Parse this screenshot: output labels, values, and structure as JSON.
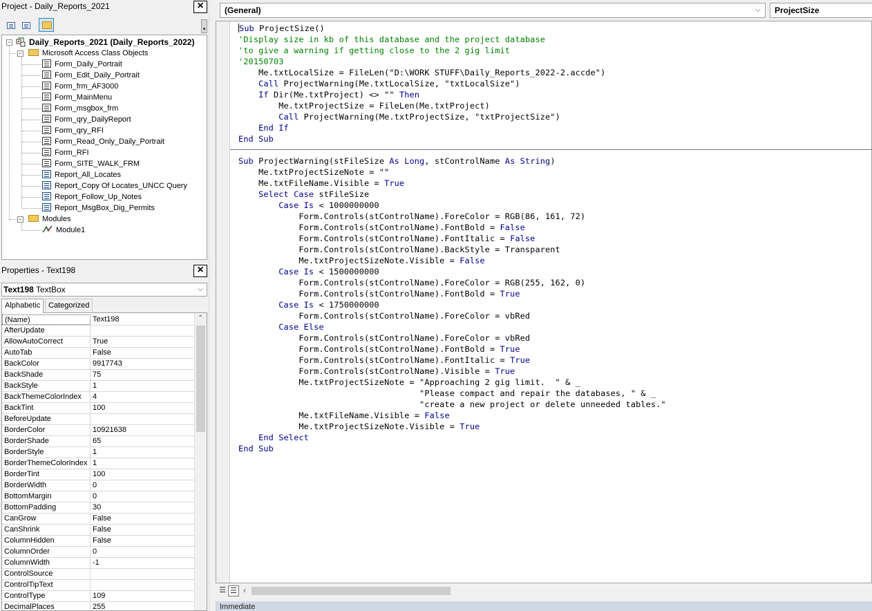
{
  "project_explorer": {
    "title": "Project - Daily_Reports_2021",
    "close": "×",
    "root_label": "Daily_Reports_2021 (Daily_Reports_2022)",
    "folders": {
      "class_objects": "Microsoft Access Class Objects",
      "modules": "Modules"
    },
    "class_items": [
      {
        "label": "Form_Daily_Portrait",
        "icon": "form"
      },
      {
        "label": "Form_Edit_Daily_Portrait",
        "icon": "form"
      },
      {
        "label": "Form_frm_AF3000",
        "icon": "form"
      },
      {
        "label": "Form_MainMenu",
        "icon": "form"
      },
      {
        "label": "Form_msgbox_frm",
        "icon": "form"
      },
      {
        "label": "Form_qry_DailyReport",
        "icon": "form"
      },
      {
        "label": "Form_qry_RFI",
        "icon": "form"
      },
      {
        "label": "Form_Read_Only_Daily_Portrait",
        "icon": "form"
      },
      {
        "label": "Form_RFI",
        "icon": "form"
      },
      {
        "label": "Form_SITE_WALK_FRM",
        "icon": "form"
      },
      {
        "label": "Report_All_Locates",
        "icon": "report"
      },
      {
        "label": "Report_Copy Of Locates_UNCC Query",
        "icon": "report"
      },
      {
        "label": "Report_Follow_Up_Notes",
        "icon": "report"
      },
      {
        "label": "Report_MsgBox_Dig_Permits",
        "icon": "report"
      }
    ],
    "module_items": [
      {
        "label": "Module1",
        "icon": "module"
      }
    ]
  },
  "properties": {
    "title": "Properties - Text198",
    "close": "×",
    "object_name": "Text198",
    "object_type": "TextBox",
    "tabs": [
      "Alphabetic",
      "Categorized"
    ],
    "active_tab": 0,
    "rows": [
      [
        "(Name)",
        "Text198"
      ],
      [
        "AfterUpdate",
        ""
      ],
      [
        "AllowAutoCorrect",
        "True"
      ],
      [
        "AutoTab",
        "False"
      ],
      [
        "BackColor",
        "9917743"
      ],
      [
        "BackShade",
        "75"
      ],
      [
        "BackStyle",
        "1"
      ],
      [
        "BackThemeColorIndex",
        "4"
      ],
      [
        "BackTint",
        "100"
      ],
      [
        "BeforeUpdate",
        ""
      ],
      [
        "BorderColor",
        "10921638"
      ],
      [
        "BorderShade",
        "65"
      ],
      [
        "BorderStyle",
        "1"
      ],
      [
        "BorderThemeColorIndex",
        "1"
      ],
      [
        "BorderTint",
        "100"
      ],
      [
        "BorderWidth",
        "0"
      ],
      [
        "BottomMargin",
        "0"
      ],
      [
        "BottomPadding",
        "30"
      ],
      [
        "CanGrow",
        "False"
      ],
      [
        "CanShrink",
        "False"
      ],
      [
        "ColumnHidden",
        "False"
      ],
      [
        "ColumnOrder",
        "0"
      ],
      [
        "ColumnWidth",
        "-1"
      ],
      [
        "ControlSource",
        ""
      ],
      [
        "ControlTipText",
        ""
      ],
      [
        "ControlType",
        "109"
      ],
      [
        "DecimalPlaces",
        "255"
      ]
    ]
  },
  "code_window": {
    "object_combo": "(General)",
    "procedure_combo": "ProjectSize",
    "immediate_title": "Immediate",
    "colors": {
      "keyword": "#00008b",
      "comment": "#008000"
    },
    "lines": [
      [
        [
          "kw",
          "Sub"
        ],
        [
          "t",
          " ProjectSize()"
        ]
      ],
      [
        [
          "cm",
          "'Display size in kb of this database and the project database"
        ]
      ],
      [
        [
          "cm",
          "'to give a warning if getting close to the 2 gig limit"
        ]
      ],
      [
        [
          "cm",
          "'20150703"
        ]
      ],
      [
        [
          "t",
          "    Me.txtLocalSize = FileLen(\"D:\\WORK STUFF\\Daily_Reports_2022-2.accde\")"
        ]
      ],
      [
        [
          "t",
          "    "
        ],
        [
          "kw",
          "Call"
        ],
        [
          "t",
          " ProjectWarning(Me.txtLocalSize, \"txtLocalSize\")"
        ]
      ],
      [
        [
          "t",
          "    "
        ],
        [
          "kw",
          "If"
        ],
        [
          "t",
          " Dir(Me.txtProject) <> \"\" "
        ],
        [
          "kw",
          "Then"
        ]
      ],
      [
        [
          "t",
          "        Me.txtProjectSize = FileLen(Me.txtProject)"
        ]
      ],
      [
        [
          "t",
          "        "
        ],
        [
          "kw",
          "Call"
        ],
        [
          "t",
          " ProjectWarning(Me.txtProjectSize, \"txtProjectSize\")"
        ]
      ],
      [
        [
          "t",
          "    "
        ],
        [
          "kw",
          "End If"
        ]
      ],
      [
        [
          "kw",
          "End Sub"
        ]
      ],
      "SEP",
      [
        [
          "kw",
          "Sub"
        ],
        [
          "t",
          " ProjectWarning(stFileSize "
        ],
        [
          "kw",
          "As Long"
        ],
        [
          "t",
          ", stControlName "
        ],
        [
          "kw",
          "As String"
        ],
        [
          "t",
          ")"
        ]
      ],
      [
        [
          "t",
          "    Me.txtProjectSizeNote = \"\""
        ]
      ],
      [
        [
          "t",
          "    Me.txtFileName.Visible = "
        ],
        [
          "kw",
          "True"
        ]
      ],
      [
        [
          "t",
          "    "
        ],
        [
          "kw",
          "Select Case"
        ],
        [
          "t",
          " stFileSize"
        ]
      ],
      [
        [
          "t",
          "        "
        ],
        [
          "kw",
          "Case Is"
        ],
        [
          "t",
          " < 1000000000"
        ]
      ],
      [
        [
          "t",
          "            Form.Controls(stControlName).ForeColor = RGB(86, 161, 72)"
        ]
      ],
      [
        [
          "t",
          "            Form.Controls(stControlName).FontBold = "
        ],
        [
          "kw",
          "False"
        ]
      ],
      [
        [
          "t",
          "            Form.Controls(stControlName).FontItalic = "
        ],
        [
          "kw",
          "False"
        ]
      ],
      [
        [
          "t",
          "            Form.Controls(stControlName).BackStyle = Transparent"
        ]
      ],
      [
        [
          "t",
          "            Me.txtProjectSizeNote.Visible = "
        ],
        [
          "kw",
          "False"
        ]
      ],
      [
        [
          "t",
          "        "
        ],
        [
          "kw",
          "Case Is"
        ],
        [
          "t",
          " < 1500000000"
        ]
      ],
      [
        [
          "t",
          "            Form.Controls(stControlName).ForeColor = RGB(255, 162, 0)"
        ]
      ],
      [
        [
          "t",
          "            Form.Controls(stControlName).FontBold = "
        ],
        [
          "kw",
          "True"
        ]
      ],
      [
        [
          "t",
          "        "
        ],
        [
          "kw",
          "Case Is"
        ],
        [
          "t",
          " < 1750000000"
        ]
      ],
      [
        [
          "t",
          "            Form.Controls(stControlName).ForeColor = vbRed"
        ]
      ],
      [
        [
          "t",
          "        "
        ],
        [
          "kw",
          "Case Else"
        ]
      ],
      [
        [
          "t",
          "            Form.Controls(stControlName).ForeColor = vbRed"
        ]
      ],
      [
        [
          "t",
          "            Form.Controls(stControlName).FontBold = "
        ],
        [
          "kw",
          "True"
        ]
      ],
      [
        [
          "t",
          "            Form.Controls(stControlName).FontItalic = "
        ],
        [
          "kw",
          "True"
        ]
      ],
      [
        [
          "t",
          "            Form.Controls(stControlName).Visible = "
        ],
        [
          "kw",
          "True"
        ]
      ],
      [
        [
          "t",
          "            Me.txtProjectSizeNote = \"Approaching 2 gig limit.  \" & _"
        ]
      ],
      [
        [
          "t",
          "                                    \"Please compact and repair the databases, \" & _"
        ]
      ],
      [
        [
          "t",
          "                                    \"create a new project or delete unneeded tables.\""
        ]
      ],
      [
        [
          "t",
          "            Me.txtFileName.Visible = "
        ],
        [
          "kw",
          "False"
        ]
      ],
      [
        [
          "t",
          "            Me.txtProjectSizeNote.Visible = "
        ],
        [
          "kw",
          "True"
        ]
      ],
      [
        [
          "t",
          "    "
        ],
        [
          "kw",
          "End Select"
        ]
      ],
      [
        [
          "kw",
          "End Sub"
        ]
      ]
    ]
  }
}
